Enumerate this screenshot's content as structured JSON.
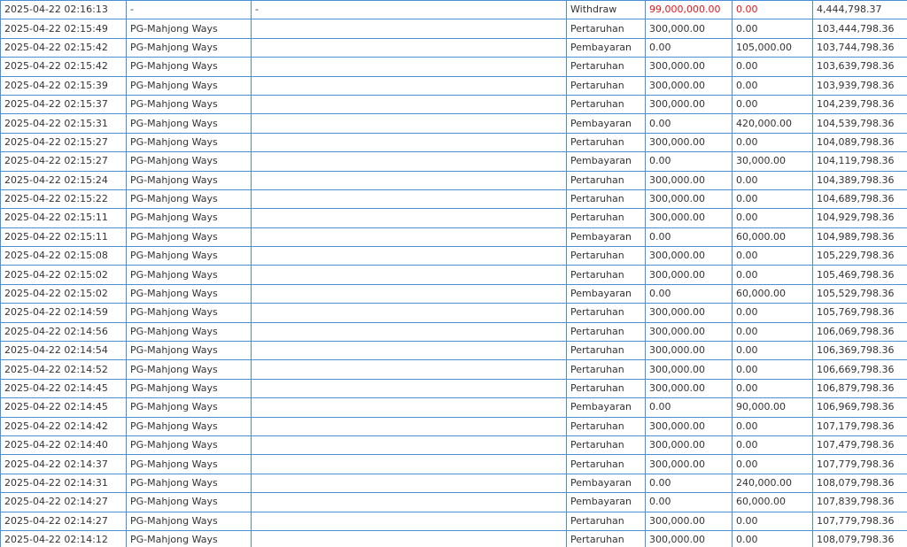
{
  "accent_color": "#e8151b",
  "border_color": "#4a90d9",
  "rows": [
    {
      "time": "2025-04-22 02:16:13",
      "game": "-",
      "detail": "-",
      "type": "Withdraw",
      "bet": "99,000,000.00",
      "payout": "0.00",
      "balance": "4,444,798.37",
      "highlight": true
    },
    {
      "time": "2025-04-22 02:15:49",
      "game": "PG-Mahjong Ways",
      "detail": "",
      "type": "Pertaruhan",
      "bet": "300,000.00",
      "payout": "0.00",
      "balance": "103,444,798.36"
    },
    {
      "time": "2025-04-22 02:15:42",
      "game": "PG-Mahjong Ways",
      "detail": "",
      "type": "Pembayaran",
      "bet": "0.00",
      "payout": "105,000.00",
      "balance": "103,744,798.36"
    },
    {
      "time": "2025-04-22 02:15:42",
      "game": "PG-Mahjong Ways",
      "detail": "",
      "type": "Pertaruhan",
      "bet": "300,000.00",
      "payout": "0.00",
      "balance": "103,639,798.36"
    },
    {
      "time": "2025-04-22 02:15:39",
      "game": "PG-Mahjong Ways",
      "detail": "",
      "type": "Pertaruhan",
      "bet": "300,000.00",
      "payout": "0.00",
      "balance": "103,939,798.36"
    },
    {
      "time": "2025-04-22 02:15:37",
      "game": "PG-Mahjong Ways",
      "detail": "",
      "type": "Pertaruhan",
      "bet": "300,000.00",
      "payout": "0.00",
      "balance": "104,239,798.36"
    },
    {
      "time": "2025-04-22 02:15:31",
      "game": "PG-Mahjong Ways",
      "detail": "",
      "type": "Pembayaran",
      "bet": "0.00",
      "payout": "420,000.00",
      "balance": "104,539,798.36"
    },
    {
      "time": "2025-04-22 02:15:27",
      "game": "PG-Mahjong Ways",
      "detail": "",
      "type": "Pertaruhan",
      "bet": "300,000.00",
      "payout": "0.00",
      "balance": "104,089,798.36"
    },
    {
      "time": "2025-04-22 02:15:27",
      "game": "PG-Mahjong Ways",
      "detail": "",
      "type": "Pembayaran",
      "bet": "0.00",
      "payout": "30,000.00",
      "balance": "104,119,798.36"
    },
    {
      "time": "2025-04-22 02:15:24",
      "game": "PG-Mahjong Ways",
      "detail": "",
      "type": "Pertaruhan",
      "bet": "300,000.00",
      "payout": "0.00",
      "balance": "104,389,798.36"
    },
    {
      "time": "2025-04-22 02:15:22",
      "game": "PG-Mahjong Ways",
      "detail": "",
      "type": "Pertaruhan",
      "bet": "300,000.00",
      "payout": "0.00",
      "balance": "104,689,798.36"
    },
    {
      "time": "2025-04-22 02:15:11",
      "game": "PG-Mahjong Ways",
      "detail": "",
      "type": "Pertaruhan",
      "bet": "300,000.00",
      "payout": "0.00",
      "balance": "104,929,798.36"
    },
    {
      "time": "2025-04-22 02:15:11",
      "game": "PG-Mahjong Ways",
      "detail": "",
      "type": "Pembayaran",
      "bet": "0.00",
      "payout": "60,000.00",
      "balance": "104,989,798.36"
    },
    {
      "time": "2025-04-22 02:15:08",
      "game": "PG-Mahjong Ways",
      "detail": "",
      "type": "Pertaruhan",
      "bet": "300,000.00",
      "payout": "0.00",
      "balance": "105,229,798.36"
    },
    {
      "time": "2025-04-22 02:15:02",
      "game": "PG-Mahjong Ways",
      "detail": "",
      "type": "Pertaruhan",
      "bet": "300,000.00",
      "payout": "0.00",
      "balance": "105,469,798.36"
    },
    {
      "time": "2025-04-22 02:15:02",
      "game": "PG-Mahjong Ways",
      "detail": "",
      "type": "Pembayaran",
      "bet": "0.00",
      "payout": "60,000.00",
      "balance": "105,529,798.36"
    },
    {
      "time": "2025-04-22 02:14:59",
      "game": "PG-Mahjong Ways",
      "detail": "",
      "type": "Pertaruhan",
      "bet": "300,000.00",
      "payout": "0.00",
      "balance": "105,769,798.36"
    },
    {
      "time": "2025-04-22 02:14:56",
      "game": "PG-Mahjong Ways",
      "detail": "",
      "type": "Pertaruhan",
      "bet": "300,000.00",
      "payout": "0.00",
      "balance": "106,069,798.36"
    },
    {
      "time": "2025-04-22 02:14:54",
      "game": "PG-Mahjong Ways",
      "detail": "",
      "type": "Pertaruhan",
      "bet": "300,000.00",
      "payout": "0.00",
      "balance": "106,369,798.36"
    },
    {
      "time": "2025-04-22 02:14:52",
      "game": "PG-Mahjong Ways",
      "detail": "",
      "type": "Pertaruhan",
      "bet": "300,000.00",
      "payout": "0.00",
      "balance": "106,669,798.36"
    },
    {
      "time": "2025-04-22 02:14:45",
      "game": "PG-Mahjong Ways",
      "detail": "",
      "type": "Pertaruhan",
      "bet": "300,000.00",
      "payout": "0.00",
      "balance": "106,879,798.36"
    },
    {
      "time": "2025-04-22 02:14:45",
      "game": "PG-Mahjong Ways",
      "detail": "",
      "type": "Pembayaran",
      "bet": "0.00",
      "payout": "90,000.00",
      "balance": "106,969,798.36"
    },
    {
      "time": "2025-04-22 02:14:42",
      "game": "PG-Mahjong Ways",
      "detail": "",
      "type": "Pertaruhan",
      "bet": "300,000.00",
      "payout": "0.00",
      "balance": "107,179,798.36"
    },
    {
      "time": "2025-04-22 02:14:40",
      "game": "PG-Mahjong Ways",
      "detail": "",
      "type": "Pertaruhan",
      "bet": "300,000.00",
      "payout": "0.00",
      "balance": "107,479,798.36"
    },
    {
      "time": "2025-04-22 02:14:37",
      "game": "PG-Mahjong Ways",
      "detail": "",
      "type": "Pertaruhan",
      "bet": "300,000.00",
      "payout": "0.00",
      "balance": "107,779,798.36"
    },
    {
      "time": "2025-04-22 02:14:31",
      "game": "PG-Mahjong Ways",
      "detail": "",
      "type": "Pembayaran",
      "bet": "0.00",
      "payout": "240,000.00",
      "balance": "108,079,798.36"
    },
    {
      "time": "2025-04-22 02:14:27",
      "game": "PG-Mahjong Ways",
      "detail": "",
      "type": "Pembayaran",
      "bet": "0.00",
      "payout": "60,000.00",
      "balance": "107,839,798.36"
    },
    {
      "time": "2025-04-22 02:14:27",
      "game": "PG-Mahjong Ways",
      "detail": "",
      "type": "Pertaruhan",
      "bet": "300,000.00",
      "payout": "0.00",
      "balance": "107,779,798.36"
    },
    {
      "time": "2025-04-22 02:14:12",
      "game": "PG-Mahjong Ways",
      "detail": "",
      "type": "Pertaruhan",
      "bet": "300,000.00",
      "payout": "0.00",
      "balance": "108,079,798.36"
    }
  ]
}
